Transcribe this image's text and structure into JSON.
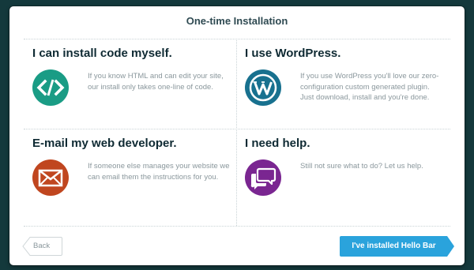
{
  "modal": {
    "title": "One-time Installation"
  },
  "options": {
    "self": {
      "title": "I can install code myself.",
      "description": "If you know HTML and can edit your site, our install only takes one-line of code.",
      "icon": "code-icon",
      "color": "#1a9c85"
    },
    "wordpress": {
      "title": "I use WordPress.",
      "description": "If you use WordPress you'll love our zero-configuration custom generated plugin. Just download, install and you're done.",
      "icon": "wordpress-icon",
      "color": "#18718f"
    },
    "developer": {
      "title": "E-mail my web developer.",
      "description": "If someone else manages your website we can email them the instructions for you.",
      "icon": "envelope-icon",
      "color": "#c0461f"
    },
    "help": {
      "title": "I need help.",
      "description": "Still not sure what to do? Let us help.",
      "icon": "chat-bubbles-icon",
      "color": "#7a2691"
    }
  },
  "footer": {
    "back_label": "Back",
    "installed_label": "I've installed Hello Bar",
    "installed_color": "#2aa3dc"
  }
}
